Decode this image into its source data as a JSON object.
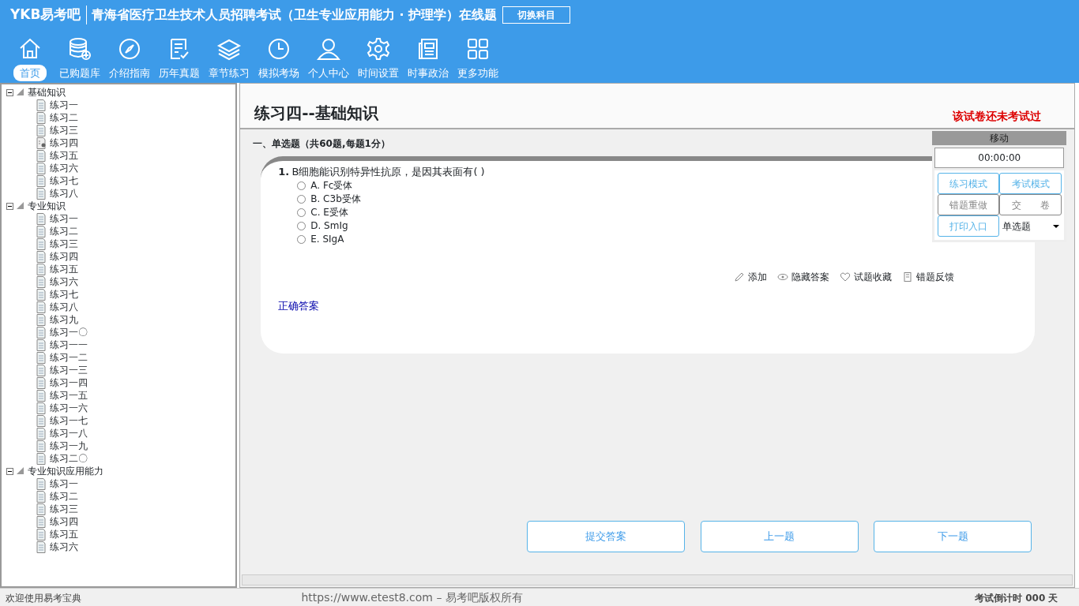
{
  "header": {
    "logo": "YKB易考吧",
    "title": "青海省医疗卫生技术人员招聘考试（卫生专业应用能力 · 护理学）在线题",
    "switch_button": "切换科目"
  },
  "toolbar": [
    {
      "label": "首页",
      "selected": true
    },
    {
      "label": "已购题库",
      "selected": false
    },
    {
      "label": "介绍指南",
      "selected": false
    },
    {
      "label": "历年真题",
      "selected": false
    },
    {
      "label": "章节练习",
      "selected": false
    },
    {
      "label": "模拟考场",
      "selected": false
    },
    {
      "label": "个人中心",
      "selected": false
    },
    {
      "label": "时间设置",
      "selected": false
    },
    {
      "label": "时事政治",
      "selected": false
    },
    {
      "label": "更多功能",
      "selected": false
    }
  ],
  "tree": [
    {
      "label": "基础知识",
      "expanded": true,
      "children": [
        {
          "label": "练习一",
          "selected": false
        },
        {
          "label": "练习二",
          "selected": false
        },
        {
          "label": "练习三",
          "selected": false
        },
        {
          "label": "练习四",
          "selected": true
        },
        {
          "label": "练习五",
          "selected": false
        },
        {
          "label": "练习六",
          "selected": false
        },
        {
          "label": "练习七",
          "selected": false
        },
        {
          "label": "练习八",
          "selected": false
        }
      ]
    },
    {
      "label": "专业知识",
      "expanded": true,
      "children": [
        {
          "label": "练习一",
          "selected": false
        },
        {
          "label": "练习二",
          "selected": false
        },
        {
          "label": "练习三",
          "selected": false
        },
        {
          "label": "练习四",
          "selected": false
        },
        {
          "label": "练习五",
          "selected": false
        },
        {
          "label": "练习六",
          "selected": false
        },
        {
          "label": "练习七",
          "selected": false
        },
        {
          "label": "练习八",
          "selected": false
        },
        {
          "label": "练习九",
          "selected": false
        },
        {
          "label": "练习一〇",
          "selected": false
        },
        {
          "label": "练习一一",
          "selected": false
        },
        {
          "label": "练习一二",
          "selected": false
        },
        {
          "label": "练习一三",
          "selected": false
        },
        {
          "label": "练习一四",
          "selected": false
        },
        {
          "label": "练习一五",
          "selected": false
        },
        {
          "label": "练习一六",
          "selected": false
        },
        {
          "label": "练习一七",
          "selected": false
        },
        {
          "label": "练习一八",
          "selected": false
        },
        {
          "label": "练习一九",
          "selected": false
        },
        {
          "label": "练习二〇",
          "selected": false
        }
      ]
    },
    {
      "label": "专业知识应用能力",
      "expanded": true,
      "children": [
        {
          "label": "练习一",
          "selected": false
        },
        {
          "label": "练习二",
          "selected": false
        },
        {
          "label": "练习三",
          "selected": false
        },
        {
          "label": "练习四",
          "selected": false
        },
        {
          "label": "练习五",
          "selected": false
        },
        {
          "label": "练习六",
          "selected": false
        }
      ]
    }
  ],
  "paper": {
    "title": "练习四--基础知识",
    "status": "该试卷还未考试过",
    "section": "一、单选题（共60题,每题1分）"
  },
  "question": {
    "number": "1.",
    "text": "B细胞能识别特异性抗原，是因其表面有( )",
    "options": [
      {
        "label": "A. Fc受体",
        "selected": false
      },
      {
        "label": "B. C3b受体",
        "selected": false
      },
      {
        "label": "C. E受体",
        "selected": false
      },
      {
        "label": "D. SmIg",
        "selected": false
      },
      {
        "label": "E. SIgA",
        "selected": false
      }
    ],
    "actions": [
      "添加",
      "隐藏答案",
      "试题收藏",
      "错题反馈"
    ],
    "answer": "正确答案"
  },
  "side_panel": {
    "title": "移动",
    "timer": "00:00:00",
    "buttons": [
      {
        "label": "练习模式",
        "disabled": false
      },
      {
        "label": "考试模式",
        "disabled": false
      },
      {
        "label": "错题重做",
        "disabled": true
      },
      {
        "label": "交　　卷",
        "disabled": true
      },
      {
        "label": "打印入口",
        "disabled": false
      }
    ],
    "type_select": "单选题"
  },
  "nav_buttons": [
    "提交答案",
    "上一题",
    "下一题"
  ],
  "status_bar": {
    "welcome": "欢迎使用易考宝典",
    "copyright": "https://www.etest8.com – 易考吧版权所有",
    "countdown": "考试倒计时 000 天"
  }
}
